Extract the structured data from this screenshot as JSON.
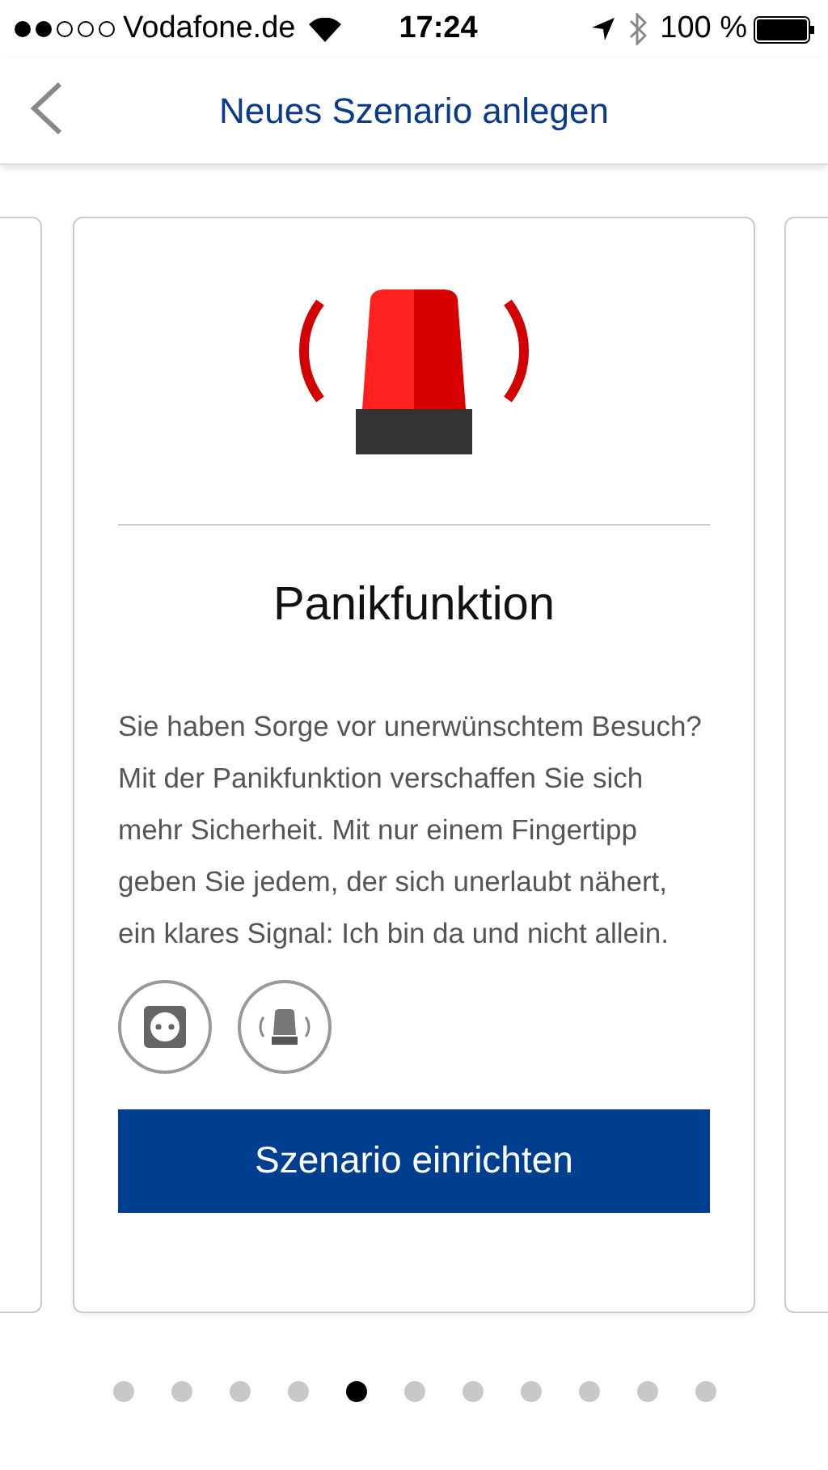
{
  "status_bar": {
    "carrier": "Vodafone.de",
    "time": "17:24",
    "battery": "100 %"
  },
  "nav": {
    "title": "Neues Szenario anlegen"
  },
  "card": {
    "title": "Panikfunktion",
    "description": "Sie haben Sorge vor unerwünschtem Besuch? Mit der Panikfunktion verschaffen Sie sich mehr Sicherheit. Mit nur einem Fingertipp geben Sie jedem, der sich unerlaubt nähert, ein klares Signal: Ich bin da und nicht allein.",
    "devices": [
      {
        "kind": "socket"
      },
      {
        "kind": "siren"
      }
    ],
    "button": "Szenario einrichten"
  },
  "pager": [
    {
      "selected": false
    },
    {
      "selected": false
    },
    {
      "selected": false
    },
    {
      "selected": false
    },
    {
      "selected": true
    },
    {
      "selected": false
    },
    {
      "selected": false
    },
    {
      "selected": false
    },
    {
      "selected": false
    },
    {
      "selected": false
    },
    {
      "selected": false
    }
  ]
}
